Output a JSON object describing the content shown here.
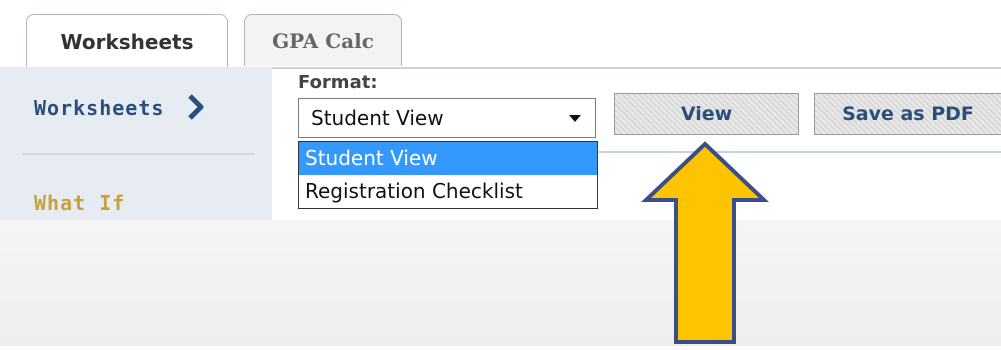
{
  "tabs": [
    {
      "label": "Worksheets",
      "active": true
    },
    {
      "label": "GPA Calc",
      "active": false
    }
  ],
  "sidebar": {
    "worksheets_label": "Worksheets",
    "whatif_label": "What If"
  },
  "format": {
    "label": "Format:",
    "selected": "Student View",
    "options": [
      "Student View",
      "Registration Checklist"
    ]
  },
  "buttons": {
    "view": "View",
    "save_pdf": "Save as PDF"
  },
  "icons": {
    "chevron": "chevron-right-icon",
    "caret": "caret-down-icon",
    "arrow": "up-arrow-annotation-icon"
  },
  "colors": {
    "brand_blue": "#2a4f7c",
    "whatif_gold": "#c9a13a",
    "selected_option": "#3399ff",
    "arrow_fill": "#ffc400",
    "arrow_stroke": "#3b4f86"
  }
}
